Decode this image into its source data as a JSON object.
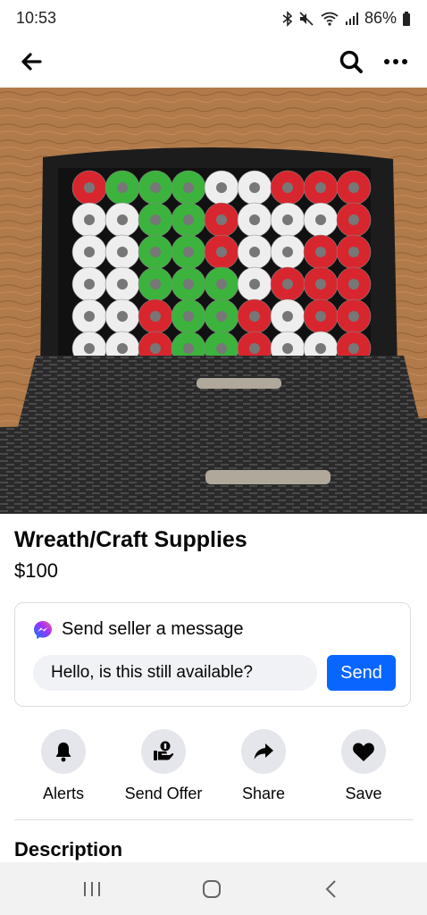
{
  "status_bar": {
    "time": "10:53",
    "battery": "86%",
    "icons": [
      "bluetooth-icon",
      "mute-icon",
      "wifi-icon",
      "signal-icon",
      "battery-icon"
    ]
  },
  "top_nav": {
    "icons": [
      "back-arrow-icon",
      "search-icon",
      "more-icon"
    ]
  },
  "listing": {
    "photo_description_icon": "product-photo",
    "title": "Wreath/Craft Supplies",
    "price": "$100"
  },
  "message_card": {
    "header": "Send seller a message",
    "input_value": "Hello, is this still available?",
    "send_label": "Send",
    "accent": "#0866ff"
  },
  "actions": [
    {
      "label": "Alerts",
      "icon": "bell-icon"
    },
    {
      "label": "Send Offer",
      "icon": "offer-icon"
    },
    {
      "label": "Share",
      "icon": "share-icon"
    },
    {
      "label": "Save",
      "icon": "heart-icon"
    }
  ],
  "description_heading": "Description",
  "android_nav": [
    "recents-icon",
    "home-icon",
    "back-icon"
  ]
}
